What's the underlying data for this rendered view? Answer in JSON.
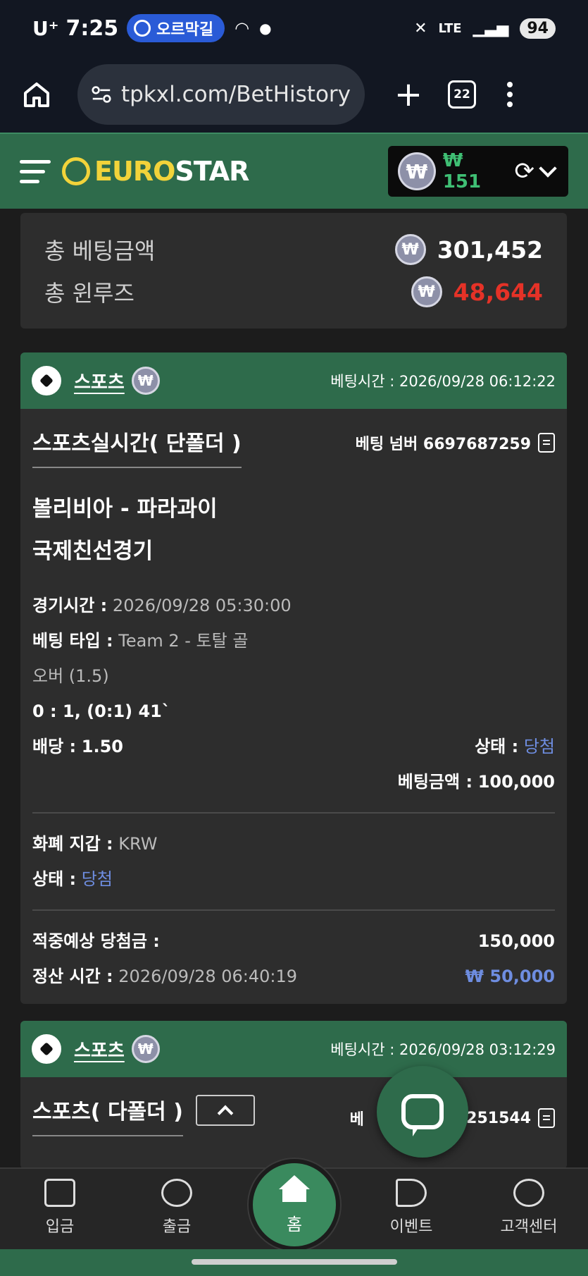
{
  "status_bar": {
    "carrier": "U⁺",
    "time": "7:25",
    "pill_label": "오르막길",
    "network": "LTE",
    "battery": "94"
  },
  "browser": {
    "url": "tpkxl.com/BetHistory",
    "tab_count": "22"
  },
  "header": {
    "logo_euro": "EURO",
    "logo_star": "STAR",
    "currency_symbol": "₩",
    "balance": "₩ 151"
  },
  "summary": {
    "total_bet_label": "총 베팅금액",
    "total_bet_value": "301,452",
    "total_winlose_label": "총 윈루즈",
    "total_winlose_value": "48,644"
  },
  "cards": [
    {
      "category": "스포츠",
      "bet_time": "베팅시간 : 2026/09/28 06:12:22",
      "bet_type": "스포츠실시간( 단폴더 )",
      "bet_number": "베팅 넘버 6697687259",
      "match": "볼리비아 - 파라과이",
      "league": "국제친선경기",
      "game_time_label": "경기시간 :",
      "game_time": "2026/09/28 05:30:00",
      "bet_kind_label": "베팅 타입 :",
      "bet_kind": "Team 2 - 토탈 골",
      "bet_kind_line2": "오버 (1.5)",
      "score": "0 : 1, (0:1) 41`",
      "odds_label": "배당 :",
      "odds": "1.50",
      "status_label": "상태 :",
      "status": "당첨",
      "bet_amount_label": "베팅금액 :",
      "bet_amount": "100,000",
      "wallet_label": "화폐 지갑 :",
      "wallet": "KRW",
      "status2_label": "상태 :",
      "status2": "당첨",
      "expected_label": "적중예상 당첨금 :",
      "expected": "150,000",
      "settle_label": "정산 시간 :",
      "settle_time": "2026/09/28 06:40:19",
      "settle_amount": "₩ 50,000"
    },
    {
      "category": "스포츠",
      "bet_time": "베팅시간 : 2026/09/28 03:12:29",
      "bet_type": "스포츠( 다폴더 )",
      "bet_number_partial": "베",
      "bet_number_tail": "7251544"
    }
  ],
  "bottom_nav": {
    "deposit": "입금",
    "withdraw": "출금",
    "home": "홈",
    "event": "이벤트",
    "support": "고객센터"
  }
}
